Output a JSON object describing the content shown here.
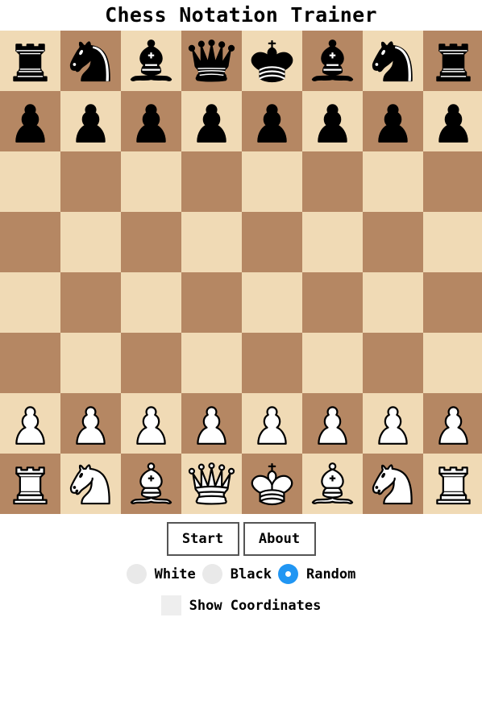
{
  "title": "Chess Notation Trainer",
  "colors": {
    "light_square": "#f0dab5",
    "dark_square": "#b58763",
    "radio_checked": "#2196f3"
  },
  "board": {
    "orientation": "white",
    "ranks": [
      [
        "bR",
        "bN",
        "bB",
        "bQ",
        "bK",
        "bB",
        "bN",
        "bR"
      ],
      [
        "bP",
        "bP",
        "bP",
        "bP",
        "bP",
        "bP",
        "bP",
        "bP"
      ],
      [
        "",
        "",
        "",
        "",
        "",
        "",
        "",
        ""
      ],
      [
        "",
        "",
        "",
        "",
        "",
        "",
        "",
        ""
      ],
      [
        "",
        "",
        "",
        "",
        "",
        "",
        "",
        ""
      ],
      [
        "",
        "",
        "",
        "",
        "",
        "",
        "",
        ""
      ],
      [
        "wP",
        "wP",
        "wP",
        "wP",
        "wP",
        "wP",
        "wP",
        "wP"
      ],
      [
        "wR",
        "wN",
        "wB",
        "wQ",
        "wK",
        "wB",
        "wN",
        "wR"
      ]
    ]
  },
  "buttons": {
    "start_label": "Start",
    "about_label": "About"
  },
  "color_choice": {
    "options": [
      {
        "label": "White",
        "checked": false
      },
      {
        "label": "Black",
        "checked": false
      },
      {
        "label": "Random",
        "checked": true
      }
    ]
  },
  "show_coordinates": {
    "label": "Show Coordinates",
    "checked": false
  }
}
